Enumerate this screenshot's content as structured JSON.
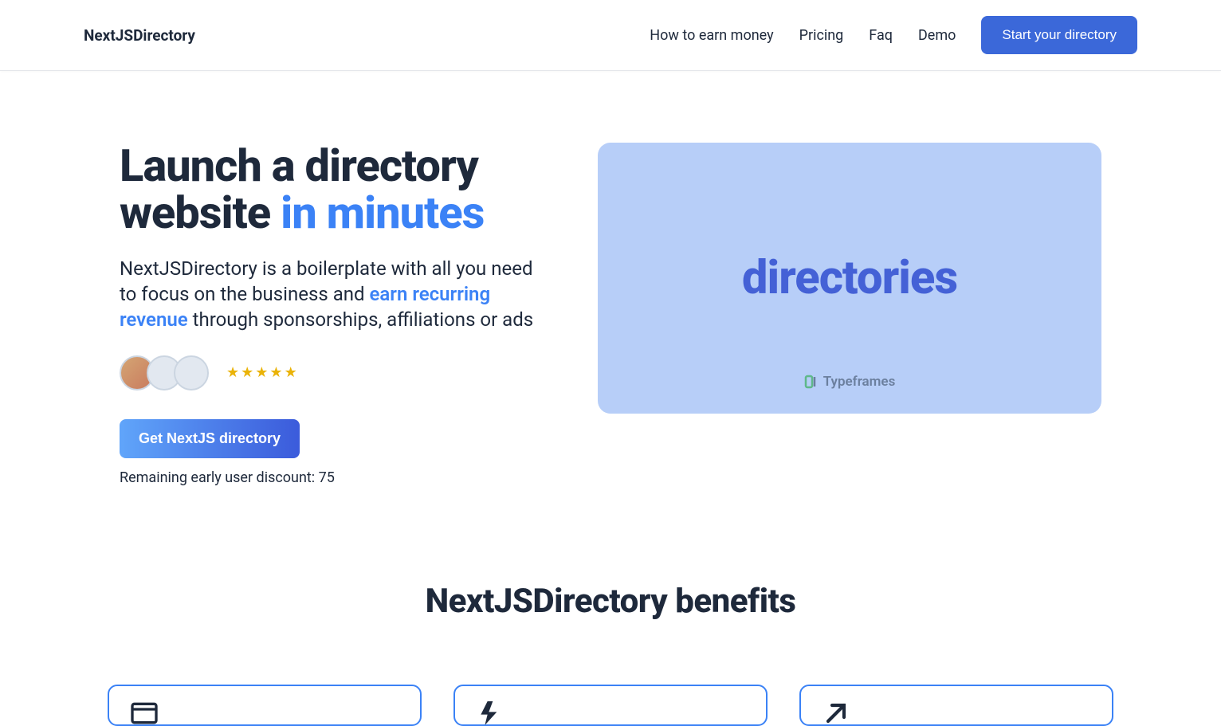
{
  "header": {
    "logo": "NextJSDirectory",
    "nav": {
      "earn": "How to earn money",
      "pricing": "Pricing",
      "faq": "Faq",
      "demo": "Demo"
    },
    "cta": "Start your directory"
  },
  "hero": {
    "title_line1": "Launch a directory",
    "title_line2a": "website ",
    "title_line2b": "in minutes",
    "subtitle_part1": "NextJSDirectory is a boilerplate with all you need to focus on the business and ",
    "subtitle_accent": "earn recurring revenue",
    "subtitle_part2": " through sponsorships, affiliations or ads",
    "rating_stars": 5,
    "cta": "Get NextJS directory",
    "discount_label": "Remaining early user discount: ",
    "discount_count": "75"
  },
  "preview": {
    "title": "directories",
    "brand": "Typeframes"
  },
  "benefits": {
    "title": "NextJSDirectory benefits"
  }
}
